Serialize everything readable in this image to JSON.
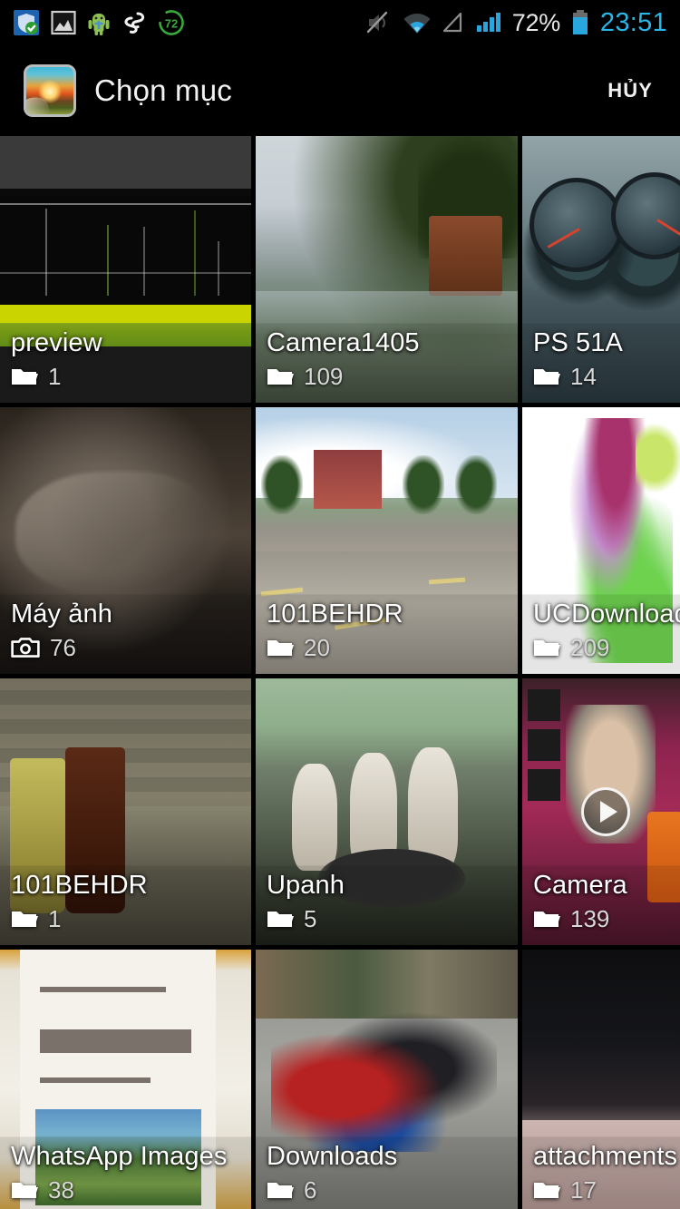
{
  "statusbar": {
    "left_icons": [
      {
        "name": "security-shield-icon"
      },
      {
        "name": "gallery-image-icon"
      },
      {
        "name": "android-robot-icon"
      },
      {
        "name": "clean-master-icon"
      },
      {
        "name": "battery-doctor-72-icon",
        "value": "72"
      }
    ],
    "right_icons": [
      {
        "name": "sound-mute-icon"
      },
      {
        "name": "wifi-icon"
      },
      {
        "name": "signal-empty-icon"
      },
      {
        "name": "signal-bars-icon"
      }
    ],
    "battery_percent": "72%",
    "clock": "23:51",
    "clock_color": "#29b6e8"
  },
  "actionbar": {
    "app_icon": "gallery-app-icon",
    "title": "Chọn mục",
    "cancel_label": "HỦY"
  },
  "grid": {
    "items": [
      {
        "name": "preview",
        "count": "1",
        "icon": "folder-icon",
        "thumb": "t-preview",
        "video": false
      },
      {
        "name": "Camera1405",
        "count": "109",
        "icon": "folder-icon",
        "thumb": "t-camera1405",
        "video": false
      },
      {
        "name": "PS 51A",
        "count": "14",
        "icon": "folder-icon",
        "thumb": "t-ps51a",
        "video": false
      },
      {
        "name": "Máy ảnh",
        "count": "76",
        "icon": "camera-icon",
        "thumb": "t-mayanh",
        "video": false
      },
      {
        "name": "101BEHDR",
        "count": "20",
        "icon": "folder-icon",
        "thumb": "t-101behdr-a",
        "video": false
      },
      {
        "name": "UCDownloads",
        "count": "209",
        "icon": "folder-icon",
        "thumb": "t-ucdl",
        "video": false
      },
      {
        "name": "101BEHDR",
        "count": "1",
        "icon": "folder-icon",
        "thumb": "t-101behdr-b",
        "video": false
      },
      {
        "name": "Upanh",
        "count": "5",
        "icon": "folder-icon",
        "thumb": "t-upanh",
        "video": false
      },
      {
        "name": "Camera",
        "count": "139",
        "icon": "folder-icon",
        "thumb": "t-cameravid",
        "video": true
      },
      {
        "name": "WhatsApp Images",
        "count": "38",
        "icon": "folder-icon",
        "thumb": "t-whatsapp",
        "video": false
      },
      {
        "name": "Downloads",
        "count": "6",
        "icon": "folder-icon",
        "thumb": "t-downloads",
        "video": false
      },
      {
        "name": "attachments",
        "count": "17",
        "icon": "folder-icon",
        "thumb": "t-attach",
        "video": false
      }
    ]
  }
}
